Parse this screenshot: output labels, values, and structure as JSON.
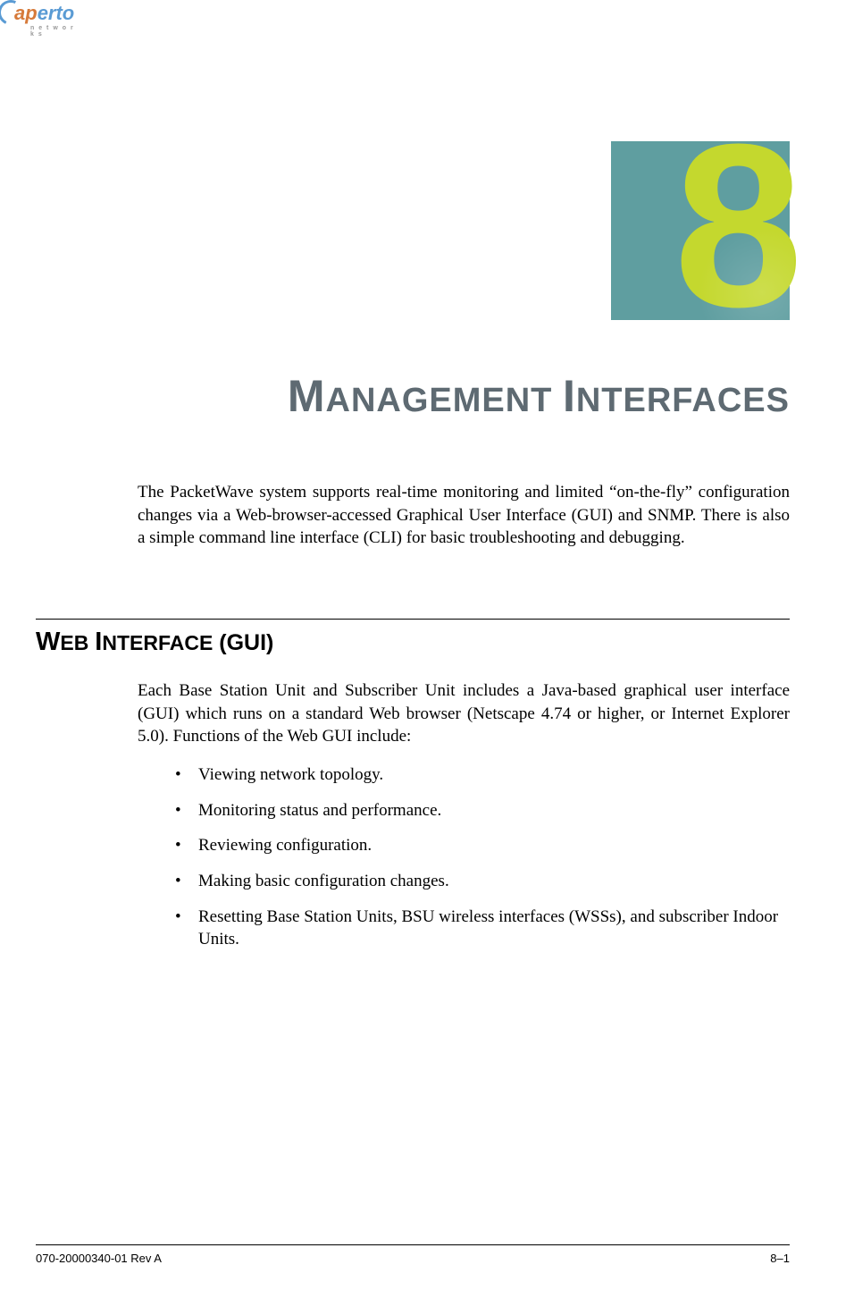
{
  "logo": {
    "part1": "ap",
    "part2": "erto",
    "subtitle": "n e t w o r k s"
  },
  "chapter": {
    "number": "8",
    "title_part1_large": "M",
    "title_part1_small": "ANAGEMENT",
    "title_part2_large": "I",
    "title_part2_small": "NTERFACES"
  },
  "intro": "The PacketWave system supports real-time monitoring and limited “on-the-fly” configuration changes via a Web-browser-accessed Graphical User Interface (GUI) and SNMP. There is also a simple command line interface (CLI) for basic troubleshooting and debugging.",
  "section": {
    "heading_part1_large": "W",
    "heading_part1_small": "EB",
    "heading_part2_large": "I",
    "heading_part2_small": "NTERFACE",
    "heading_part3": "(GUI)",
    "intro": "Each Base Station Unit and Subscriber Unit includes a Java-based graphical user interface (GUI) which runs on a standard Web browser (Netscape 4.74 or higher, or Internet Explorer 5.0). Functions of the Web GUI include:",
    "bullets": [
      "Viewing network topology.",
      "Monitoring status and performance.",
      "Reviewing configuration.",
      "Making basic configuration changes.",
      "Resetting Base Station Units, BSU wireless interfaces (WSSs), and subscriber Indoor Units."
    ]
  },
  "footer": {
    "left": "070-20000340-01 Rev A",
    "right": "8–1"
  }
}
